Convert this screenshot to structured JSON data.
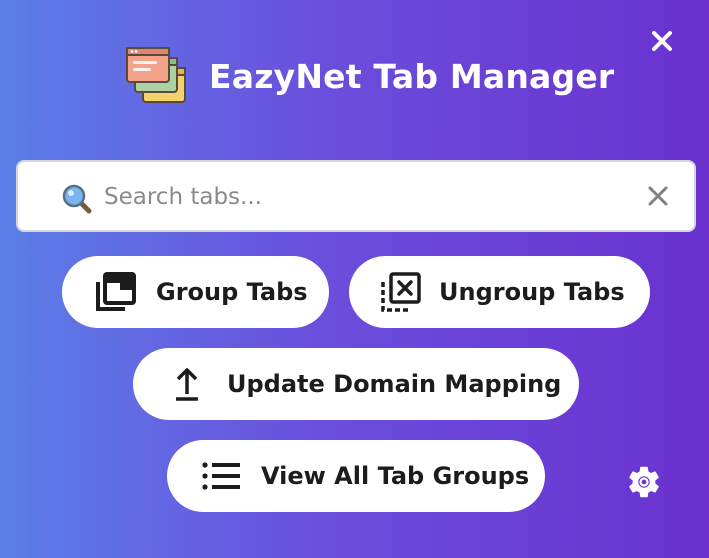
{
  "header": {
    "title": "EazyNet Tab Manager",
    "logo_icon": "stacked-windows-icon"
  },
  "close": {
    "icon": "close-icon",
    "color": "#ffffff"
  },
  "search": {
    "placeholder": "Search tabs...",
    "value": "",
    "icon": "search-icon",
    "clear_icon": "clear-icon"
  },
  "actions": {
    "group_tabs": {
      "label": "Group Tabs",
      "icon": "group-tabs-icon"
    },
    "ungroup_tabs": {
      "label": "Ungroup Tabs",
      "icon": "ungroup-tabs-icon"
    },
    "update_domain_mapping": {
      "label": "Update Domain Mapping",
      "icon": "upload-icon"
    },
    "view_all_groups": {
      "label": "View All Tab Groups",
      "icon": "list-icon"
    }
  },
  "settings": {
    "icon": "gear-icon"
  },
  "colors": {
    "gradient_start": "#5b7fe8",
    "gradient_end": "#6a31cf",
    "button_bg": "#ffffff",
    "text_dark": "#1c1c1c"
  }
}
